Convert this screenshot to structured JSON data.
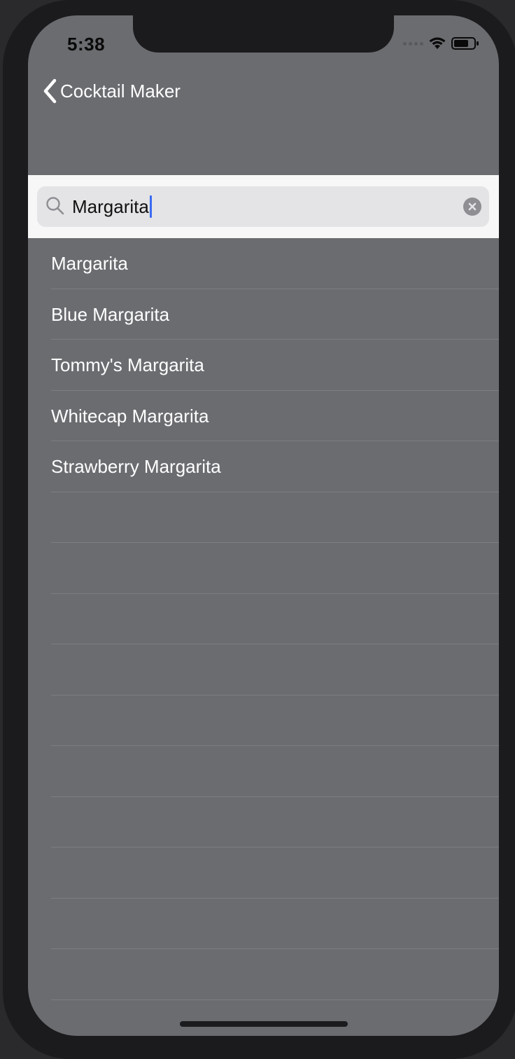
{
  "status_bar": {
    "time": "5:38"
  },
  "nav": {
    "back_label": "Cocktail Maker"
  },
  "search": {
    "value": "Margarita"
  },
  "results": [
    "Margarita",
    "Blue Margarita",
    "Tommy's Margarita",
    "Whitecap Margarita",
    "Strawberry Margarita"
  ],
  "empty_row_count_visible": 10,
  "colors": {
    "background": "#6b6c70",
    "search_bar": "#f7f7f7",
    "search_field": "#e4e4e6",
    "caret": "#3b6bf2",
    "row_text": "#ffffff"
  }
}
